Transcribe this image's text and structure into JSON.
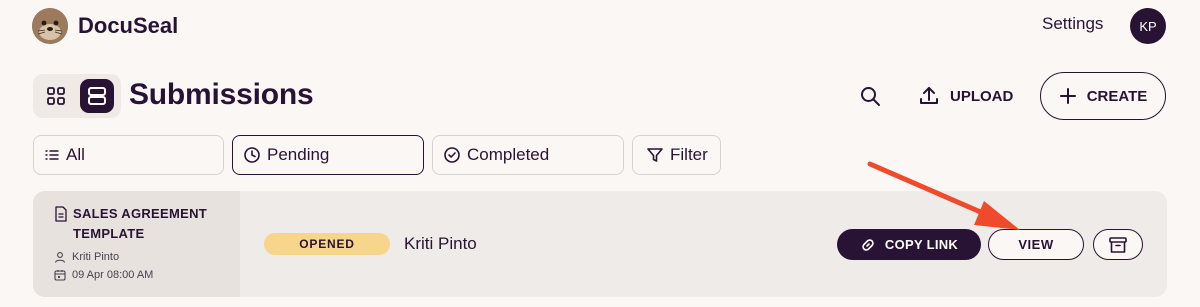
{
  "header": {
    "brand": "DocuSeal",
    "settings_label": "Settings",
    "avatar_initials": "KP"
  },
  "page": {
    "title": "Submissions",
    "upload_label": "UPLOAD",
    "create_label": "CREATE"
  },
  "filters": {
    "all": "All",
    "pending": "Pending",
    "completed": "Completed",
    "filter": "Filter",
    "active": "Pending"
  },
  "submission": {
    "template_name": "SALES AGREEMENT TEMPLATE",
    "author": "Kriti Pinto",
    "date": "09 Apr 08:00 AM",
    "status": "OPENED",
    "signer": "Kriti Pinto",
    "copy_link_label": "COPY LINK",
    "view_label": "VIEW"
  },
  "colors": {
    "accent": "#291334",
    "background": "#faf7f5",
    "status_opened": "#f7d58a",
    "annotation_arrow": "#f04a2c"
  },
  "icons": [
    "otter-logo",
    "grid-view-icon",
    "list-view-icon",
    "search-icon",
    "upload-icon",
    "plus-icon",
    "list-icon",
    "clock-icon",
    "check-circle-icon",
    "funnel-icon",
    "document-icon",
    "user-icon",
    "calendar-icon",
    "link-icon",
    "archive-icon"
  ]
}
